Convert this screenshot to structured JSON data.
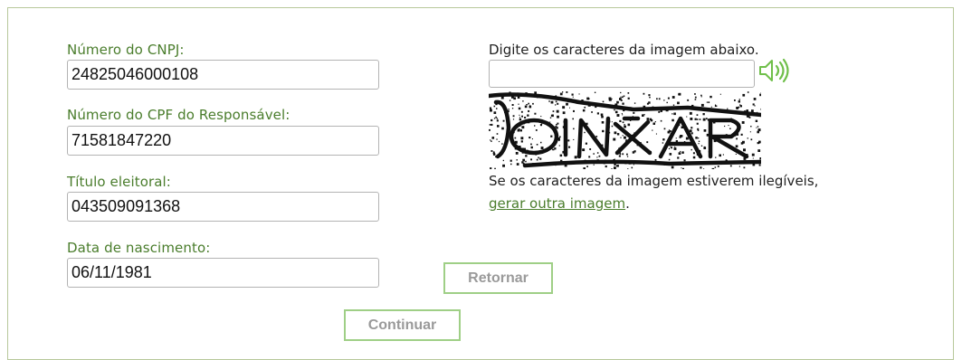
{
  "form": {
    "cnpj": {
      "label": "Número do CNPJ:",
      "value": "24825046000108"
    },
    "cpf": {
      "label": "Número do CPF do Responsável:",
      "value": "71581847220"
    },
    "titulo": {
      "label": "Título eleitoral:",
      "value": "043509091368"
    },
    "nascimento": {
      "label": "Data de nascimento:",
      "value": "06/11/1981"
    }
  },
  "captcha": {
    "instruction": "Digite os caracteres da imagem abaixo.",
    "input_value": "",
    "image_text": "OINxAR",
    "audio_icon": "speaker-icon",
    "help_text": "Se os caracteres da imagem estiverem ilegíveis,",
    "regenerate_link": "gerar outra imagem",
    "regenerate_suffix": "."
  },
  "buttons": {
    "return_label": "Retornar",
    "continue_label": "Continuar"
  },
  "colors": {
    "label_green": "#4a7d2c",
    "border_green": "#9fcf86",
    "frame_border": "#b7c89a"
  }
}
